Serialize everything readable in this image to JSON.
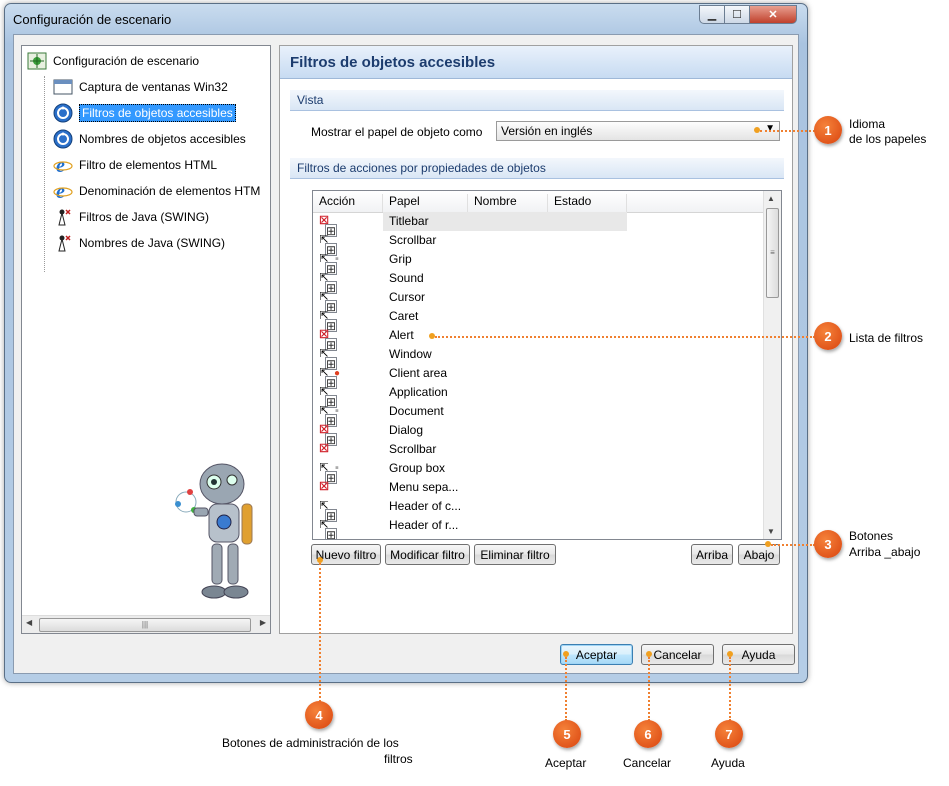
{
  "window": {
    "title": "Configuración de escenario",
    "controls": {
      "minimize": "▁",
      "maximize": "☐",
      "close": "✕"
    }
  },
  "tree": {
    "root": {
      "label": "Configuración de escenario",
      "icon": "scenario-config-icon"
    },
    "items": [
      {
        "label": "Captura de ventanas Win32",
        "icon": "window-icon"
      },
      {
        "label": "Filtros de objetos accesibles",
        "icon": "accessibility-icon",
        "selected": true
      },
      {
        "label": "Nombres de objetos accesibles",
        "icon": "accessibility-icon"
      },
      {
        "label": "Filtro de elementos HTML",
        "icon": "ie-icon"
      },
      {
        "label": "Denominación de elementos HTM",
        "icon": "ie-icon"
      },
      {
        "label": "Filtros de Java (SWING)",
        "icon": "java-icon"
      },
      {
        "label": "Nombres de Java (SWING)",
        "icon": "java-icon"
      }
    ]
  },
  "panel": {
    "title": "Filtros de objetos accesibles",
    "vista_section": "Vista",
    "role_label": "Mostrar el papel de objeto como",
    "role_value": "Versión en inglés",
    "filters_section": "Filtros de acciones por propiedades de objetos",
    "columns": [
      "Acción",
      "Papel",
      "Nombre",
      "Estado"
    ],
    "rows": [
      {
        "papel": "Titlebar",
        "icons": "x-tree",
        "selected": true
      },
      {
        "papel": "Scrollbar",
        "icons": "cursor-tree"
      },
      {
        "papel": "Grip",
        "icons": "cursor-gray-tree"
      },
      {
        "papel": "Sound",
        "icons": "cursor-tree"
      },
      {
        "papel": "Cursor",
        "icons": "cursor-tree"
      },
      {
        "papel": "Caret",
        "icons": "cursor-tree"
      },
      {
        "papel": "Alert",
        "icons": "x-tree"
      },
      {
        "papel": "Window",
        "icons": "cursor-tree"
      },
      {
        "papel": "Client area",
        "icons": "cursor-bang-tree"
      },
      {
        "papel": "Application",
        "icons": "cursor-tree"
      },
      {
        "papel": "Document",
        "icons": "cursor-gray-tree"
      },
      {
        "papel": "Dialog",
        "icons": "x-tree"
      },
      {
        "papel": "Scrollbar",
        "icons": "x"
      },
      {
        "papel": "Group box",
        "icons": "cursor-gray-tree"
      },
      {
        "papel": "Menu sepa...",
        "icons": "x"
      },
      {
        "papel": "Header of c...",
        "icons": "cursor-tree"
      },
      {
        "papel": "Header of r...",
        "icons": "cursor-tree"
      }
    ],
    "buttons": {
      "new": "Nuevo filtro",
      "edit": "Modificar filtro",
      "delete": "Eliminar filtro",
      "up": "Arriba",
      "down": "Abajo"
    }
  },
  "footer": {
    "ok": "Aceptar",
    "cancel": "Cancelar",
    "help": "Ayuda"
  },
  "annotations": {
    "c1": {
      "num": "1",
      "text1": "Idioma",
      "text2": "de los papeles"
    },
    "c2": {
      "num": "2",
      "text": "Lista de filtros"
    },
    "c3": {
      "num": "3",
      "text1": "Botones",
      "text2": "Arriba _abajo"
    },
    "c4": {
      "num": "4",
      "text1": "Botones de administración de los",
      "text2": "filtros"
    },
    "c5": {
      "num": "5",
      "text": "Aceptar"
    },
    "c6": {
      "num": "6",
      "text": "Cancelar"
    },
    "c7": {
      "num": "7",
      "text": "Ayuda"
    }
  },
  "colors": {
    "accent": "#1c3c6e",
    "callout": "#e8561a",
    "selection": "#3399ff"
  }
}
